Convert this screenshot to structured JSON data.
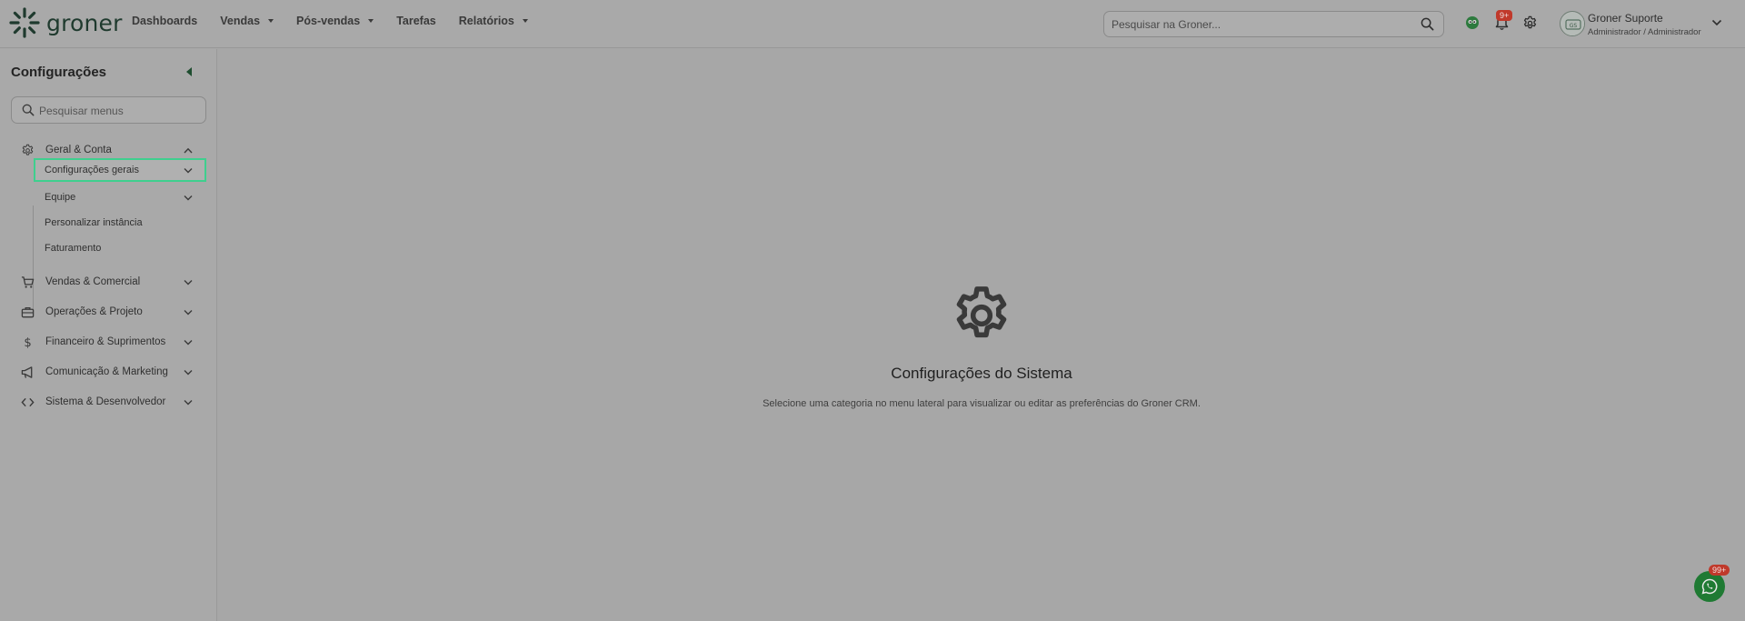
{
  "brand": {
    "name": "groner"
  },
  "nav": [
    {
      "label": "Dashboards",
      "dropdown": false
    },
    {
      "label": "Vendas",
      "dropdown": true
    },
    {
      "label": "Pós-vendas",
      "dropdown": true
    },
    {
      "label": "Tarefas",
      "dropdown": false
    },
    {
      "label": "Relatórios",
      "dropdown": true
    }
  ],
  "search": {
    "placeholder": "Pesquisar na Groner..."
  },
  "notifications": {
    "badge": "9+"
  },
  "user": {
    "name": "Groner Suporte",
    "role": "Administrador / Administrador"
  },
  "sidebar": {
    "title": "Configurações",
    "search_placeholder": "Pesquisar menus",
    "groups": [
      {
        "label": "Geral & Conta",
        "icon": "gear-icon",
        "expanded": true,
        "items": [
          {
            "label": "Configurações gerais",
            "has_children": true,
            "active": true
          },
          {
            "label": "Equipe",
            "has_children": true
          },
          {
            "label": "Personalizar instância",
            "has_children": false
          },
          {
            "label": "Faturamento",
            "has_children": false
          }
        ]
      },
      {
        "label": "Vendas & Comercial",
        "icon": "cart-icon"
      },
      {
        "label": "Operações & Projeto",
        "icon": "briefcase-icon"
      },
      {
        "label": "Financeiro & Suprimentos",
        "icon": "dollar-icon"
      },
      {
        "label": "Comunicação & Marketing",
        "icon": "megaphone-icon"
      },
      {
        "label": "Sistema & Desenvolvedor",
        "icon": "code-icon"
      }
    ]
  },
  "main": {
    "title": "Configurações do Sistema",
    "description": "Selecione uma categoria no menu lateral para visualizar ou editar as preferências do Groner CRM."
  },
  "whatsapp": {
    "badge": "99+"
  },
  "colors": {
    "accent": "#3fcf8e",
    "brand_dark": "#1f3a2e",
    "badge": "#c0392b"
  }
}
